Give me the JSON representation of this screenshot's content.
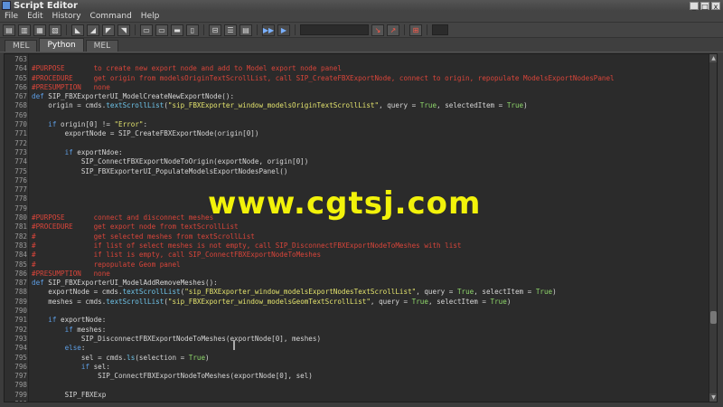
{
  "window": {
    "title": "Script Editor",
    "minimize": "_",
    "restore": "□",
    "close": "x"
  },
  "menu": [
    "File",
    "Edit",
    "History",
    "Command",
    "Help"
  ],
  "tabs": [
    {
      "label": "MEL",
      "active": false
    },
    {
      "label": "Python",
      "active": true
    },
    {
      "label": "MEL",
      "active": false
    }
  ],
  "watermark": "www.cgtsj.com",
  "lines": [
    {
      "n": "763",
      "code": ""
    },
    {
      "n": "764",
      "code": "#PURPOSE       to create new export node and add to Model export node panel"
    },
    {
      "n": "765",
      "code": "#PROCEDURE     get origin from modelsOriginTextScrollList, call SIP_CreateFBXExportNode, connect to origin, repopulate ModelsExportNodesPanel"
    },
    {
      "n": "766",
      "code": "#PRESUMPTION   none"
    },
    {
      "n": "767",
      "code": "def SIP_FBXExporterUI_ModelCreateNewExportNode():"
    },
    {
      "n": "768",
      "code": "    origin = cmds.textScrollList(\"sip_FBXExporter_window_modelsOriginTextScrollList\", query = True, selectedItem = True)"
    },
    {
      "n": "769",
      "code": ""
    },
    {
      "n": "770",
      "code": "    if origin[0] != \"Error\":"
    },
    {
      "n": "771",
      "code": "        exportNode = SIP_CreateFBXExportNode(origin[0])"
    },
    {
      "n": "772",
      "code": ""
    },
    {
      "n": "773",
      "code": "        if exportNdoe:"
    },
    {
      "n": "774",
      "code": "            SIP_ConnectFBXExportNodeToOrigin(exportNode, origin[0])"
    },
    {
      "n": "775",
      "code": "            SIP_FBXExporterUI_PopulateModelsExportNodesPanel()"
    },
    {
      "n": "776",
      "code": ""
    },
    {
      "n": "777",
      "code": ""
    },
    {
      "n": "778",
      "code": ""
    },
    {
      "n": "779",
      "code": ""
    },
    {
      "n": "780",
      "code": "#PURPOSE       connect and disconnect meshes"
    },
    {
      "n": "781",
      "code": "#PROCEDURE     get export node from textScrollList"
    },
    {
      "n": "782",
      "code": "#              get selected meshes from textScrollList"
    },
    {
      "n": "783",
      "code": "#              if list of select meshes is not empty, call SIP_DisconnectFBXExportNodeToMeshes with list"
    },
    {
      "n": "784",
      "code": "#              if list is empty, call SIP_ConnectFBXExportNodeToMeshes"
    },
    {
      "n": "785",
      "code": "#              repopulate Geom panel"
    },
    {
      "n": "786",
      "code": "#PRESUMPTION   none"
    },
    {
      "n": "787",
      "code": "def SIP_FBXExporterUI_ModelAddRemoveMeshes():"
    },
    {
      "n": "788",
      "code": "    exportNode = cmds.textScrollList(\"sip_FBXExporter_window_modelsExportNodesTextScrollList\", query = True, selectItem = True)"
    },
    {
      "n": "789",
      "code": "    meshes = cmds.textScrollList(\"sip_FBXExporter_window_modelsGeomTextScrollList\", query = True, selectItem = True)"
    },
    {
      "n": "790",
      "code": ""
    },
    {
      "n": "791",
      "code": "    if exportNode:"
    },
    {
      "n": "792",
      "code": "        if meshes:"
    },
    {
      "n": "793",
      "code": "            SIP_DisconnectFBXExportNodeToMeshes(exportNode[0], meshes)"
    },
    {
      "n": "794",
      "code": "        else:"
    },
    {
      "n": "795",
      "code": "            sel = cmds.ls(selection = True)"
    },
    {
      "n": "796",
      "code": "            if sel:"
    },
    {
      "n": "797",
      "code": "                SIP_ConnectFBXExportNodeToMeshes(exportNode[0], sel)"
    },
    {
      "n": "798",
      "code": ""
    },
    {
      "n": "799",
      "code": "        SIP_FBXExp"
    },
    {
      "n": "800",
      "code": ""
    },
    {
      "n": "801",
      "code": ""
    }
  ]
}
